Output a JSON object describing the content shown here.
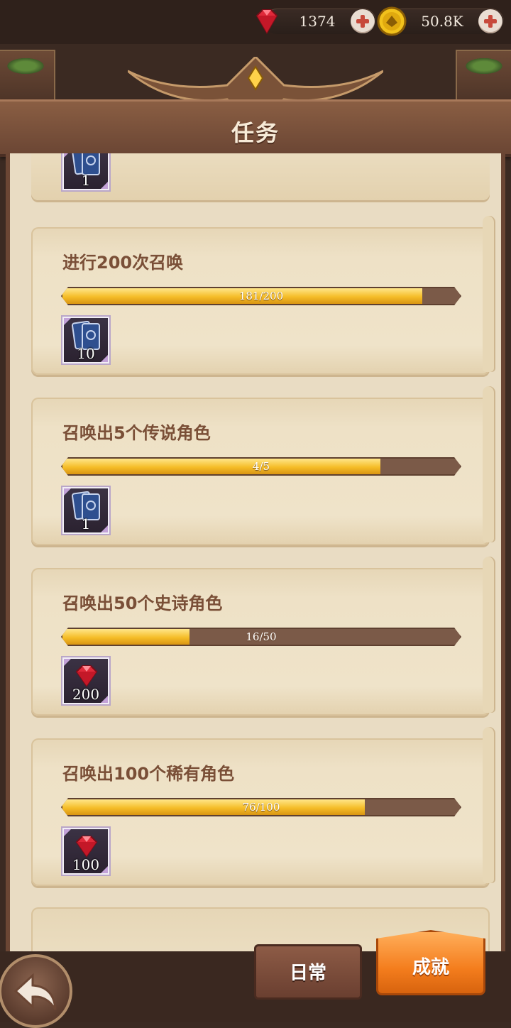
{
  "currencies": {
    "gems": {
      "value": "1374",
      "icon": "gem-icon"
    },
    "gold": {
      "value": "50.8K",
      "icon": "gold-coin-icon"
    }
  },
  "header": {
    "title": "任务"
  },
  "tasks": [
    {
      "title": "进行200次召唤",
      "progress_text": "181/200",
      "progress": 0.905,
      "reward": {
        "type": "summon-card",
        "qty": "10"
      }
    },
    {
      "title": "召唤出5个传说角色",
      "progress_text": "4/5",
      "progress": 0.8,
      "reward": {
        "type": "summon-card",
        "qty": "1"
      }
    },
    {
      "title": "召唤出50个史诗角色",
      "progress_text": "16/50",
      "progress": 0.32,
      "reward": {
        "type": "gem",
        "qty": "200"
      }
    },
    {
      "title": "召唤出100个稀有角色",
      "progress_text": "76/100",
      "progress": 0.76,
      "reward": {
        "type": "gem",
        "qty": "100"
      }
    }
  ],
  "partial_top_reward": {
    "type": "summon-card",
    "qty": "1"
  },
  "tabs": {
    "daily": "日常",
    "achievements": "成就",
    "active": "achievements"
  },
  "colors": {
    "progress_fill": "#f5bd28",
    "active_tab": "#f47d1d",
    "title_text": "#7a4f37"
  }
}
